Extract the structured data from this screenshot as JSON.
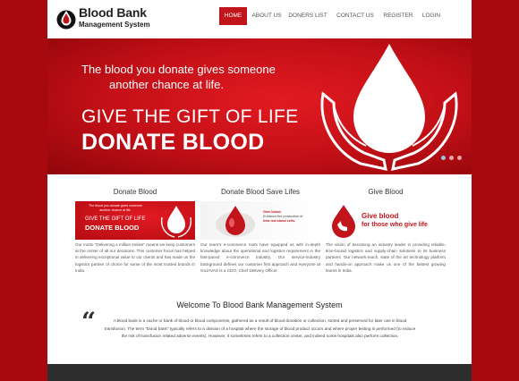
{
  "logo": {
    "line1": "Blood Bank",
    "line2": "Management System"
  },
  "nav": [
    {
      "label": "HOME",
      "active": true
    },
    {
      "label": "ABOUT US",
      "active": false
    },
    {
      "label": "DONERS LIST",
      "active": false
    },
    {
      "label": "CONTACT US",
      "active": false
    },
    {
      "label": "REGISTER",
      "active": false
    },
    {
      "label": "LOGIN",
      "active": false
    }
  ],
  "banner": {
    "line1": "The blood you donate gives someone",
    "line2": "another chance at life.",
    "headline": "GIVE THE GIFT OF LIFE",
    "cta": "DONATE BLOOD",
    "slides": 3,
    "active_slide": 1
  },
  "columns": [
    {
      "title": "Donate Blood",
      "thumb": {
        "line1": "The blood you donate gives someone",
        "line2": "another chance at life.",
        "line3": "GIVE THE GIFT OF LIFE",
        "line4": "DONATE BLOOD"
      },
      "text": "Our motto \"Delivering a million smiles\" means we keep customers at the center of all our decisions. This customer focus has helped in delivering exceptional value to our clients and has made us the logistics partner of choice for some of the most trusted brands in India."
    },
    {
      "title": "Donate Blood Save Lifes",
      "thumb": {
        "line1": "Give blood.",
        "line2": "Enhance the production of",
        "line3": "new red blood cells."
      },
      "text": "Our team's e-commerce roots have equipped us with in-depth knowledge about the operational and logistics requirement in the fast-paced e-commerce industry. Our service-industry background defines our customer first approach and everyone at GoJAVAS is a CDO, Chief Delivery Officer."
    },
    {
      "title": "Give Blood",
      "thumb": {
        "line1": "Give blood",
        "line2": "for those who give life"
      },
      "text": "The vision of becoming an industry leader in providing reliable, time-bound logistics and supply-chain solutions to its business partners. Our network-reach, state of the art technology platform and hands-on approach make us one of the fastest growing teams in India."
    }
  ],
  "welcome": {
    "title": "Welcome To Blood Bank Management System",
    "quote": "“",
    "text": "A blood bank is a cache or bank of blood or blood components, gathered as a result of blood donation or collection, stored and preserved for later use in blood transfusion. The term \"blood bank\" typically refers to a division of a hospital where the storage of blood product occurs and where proper testing is performed (to reduce the risk of transfusion related adverse events). However, it sometimes refers to a collection center, and indeed some hospitals also perform collection."
  },
  "colors": {
    "brand_red": "#c1141b",
    "outer_bg": "#a8090f",
    "footer": "#2d2d2d"
  }
}
